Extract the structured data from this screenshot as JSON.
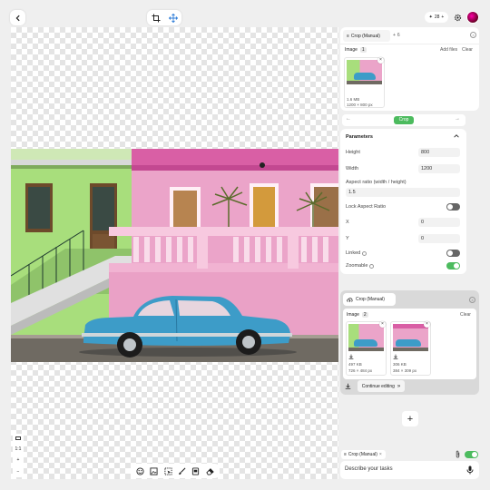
{
  "toolbar": {
    "back_icon": "chevron-left-icon",
    "crop_icon": "crop-icon",
    "move_icon": "move-icon",
    "credits_count": "28",
    "settings_icon": "gear-icon",
    "avatar_icon": "avatar"
  },
  "zoom": {
    "ratio_label": "1:1",
    "plus": "+",
    "minus": "−"
  },
  "bottom_tools": [
    "face-icon",
    "image-swap-icon",
    "select-icon",
    "brush-icon",
    "frame-icon",
    "eraser-icon"
  ],
  "panel": {
    "tab_active": "Crop (Manual)",
    "tab_add": "+",
    "tab_count": "6",
    "image_section": {
      "title": "Image",
      "count": "1",
      "add_files": "Add files",
      "clear": "Clear",
      "thumb_size": "1.6 MB",
      "thumb_dims": "1200 × 800 px"
    },
    "nav": {
      "prev": "←",
      "current": "Crop",
      "next": "→"
    },
    "parameters": {
      "title": "Parameters",
      "height_label": "Height",
      "height_value": "800",
      "width_label": "Width",
      "width_value": "1200",
      "aspect_label": "Aspect ratio (width / height)",
      "aspect_value": "1.5",
      "lock_label": "Lock Aspect Ratio",
      "lock_on": false,
      "x_label": "X",
      "x_value": "0",
      "y_label": "Y",
      "y_value": "0",
      "linked_label": "Linked",
      "linked_on": false,
      "zoomable_label": "Zoomable",
      "zoomable_on": true
    }
  },
  "result": {
    "title": "Crop (Manual)",
    "image_label": "Image",
    "image_count": "2",
    "clear": "Clear",
    "thumbs": [
      {
        "size": "497 KB",
        "dims": "726 × 484 px"
      },
      {
        "size": "306 KB",
        "dims": "384 × 309 px"
      }
    ],
    "continue_label": "Continue editing",
    "continue_icon": "double-chevron-right-icon"
  },
  "add_step": "+",
  "chat": {
    "chip_label": "Crop (Manual)",
    "chip_close": "×",
    "placeholder": "Describe your tasks",
    "toggle_on": true
  },
  "colors": {
    "accent_green": "#4cbb5e",
    "toggle_off": "#666666",
    "pink_wall": "#eaa1c6",
    "green_wall": "#a6e07a",
    "car_blue": "#3d9cc8"
  }
}
